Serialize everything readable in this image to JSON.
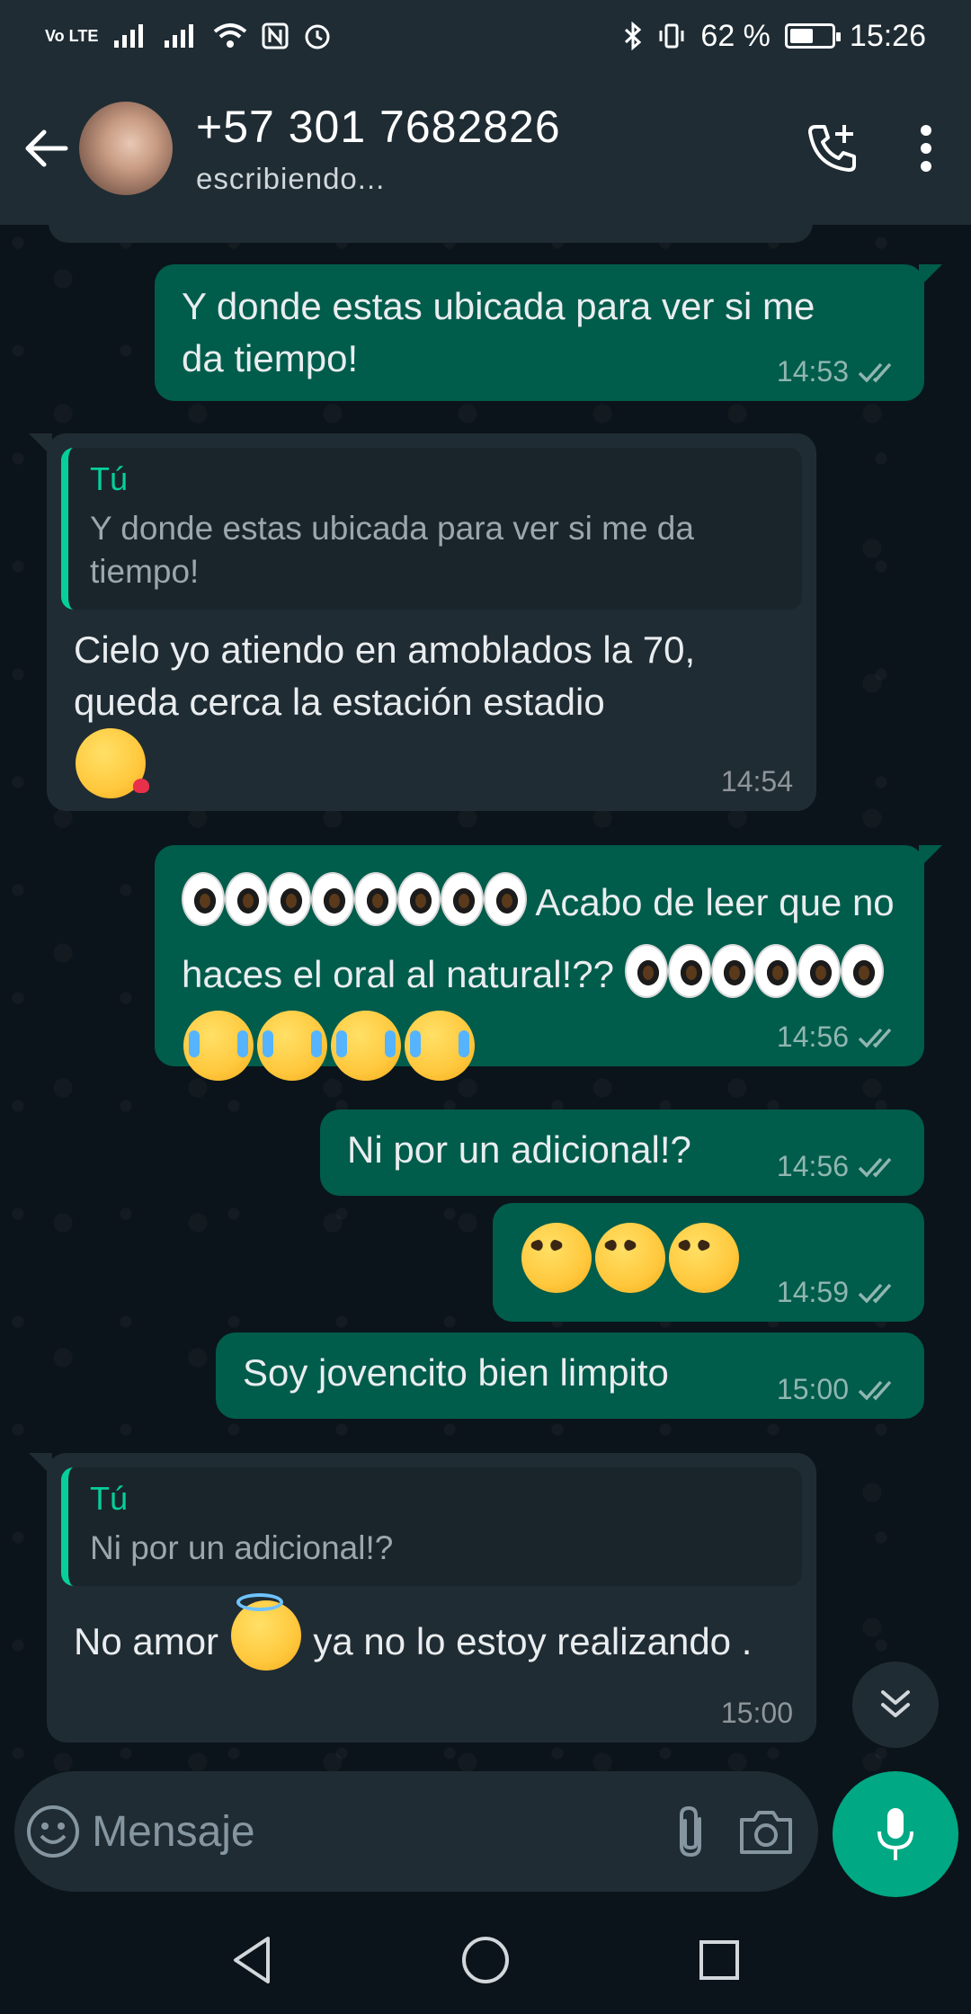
{
  "status_bar": {
    "left_network": "Vo LTE",
    "battery_percent_text": "62 %",
    "battery_level": 0.62,
    "time": "15:26"
  },
  "header": {
    "contact_name": "+57 301 7682826",
    "contact_status": "escribiendo..."
  },
  "messages": [
    {
      "direction": "out",
      "text": "Y donde estas ubicada para ver si me da tiempo!",
      "time": "14:53",
      "status": "read"
    },
    {
      "direction": "in",
      "quote_author": "Tú",
      "quote_text": "Y donde estas ubicada para ver si me da tiempo!",
      "text": "Cielo yo atiendo en amoblados la 70, queda cerca la estación estadio",
      "emoji": "kissing-face-with-heart",
      "time": "14:54"
    },
    {
      "direction": "out",
      "text": "Acabo de leer que no haces el oral al natural!??",
      "emoji_before": "eyes x4",
      "emoji_after": "eyes x3, crying x4",
      "time": "14:56",
      "status": "read"
    },
    {
      "direction": "out",
      "text": "Ni por un adicional!?",
      "time": "14:56",
      "status": "read"
    },
    {
      "direction": "out",
      "text": "",
      "emoji": "pleading-face x3",
      "time": "14:59",
      "status": "read"
    },
    {
      "direction": "out",
      "text": "Soy jovencito bien limpito",
      "time": "15:00",
      "status": "read"
    },
    {
      "direction": "in",
      "quote_author": "Tú",
      "quote_text": "Ni por un adicional!?",
      "text_part1": "No amor",
      "emoji": "smiling-face-with-halo",
      "text_part2": "ya no lo estoy realizando .",
      "time": "15:00"
    }
  ],
  "composer": {
    "placeholder": "Mensaje"
  },
  "colors": {
    "outgoing_bubble": "#005c4b",
    "incoming_bubble": "#202c33",
    "accent": "#00a884",
    "quote_accent": "#06cf9c",
    "header": "#1f2c34",
    "background": "#0b141a"
  },
  "icons": [
    "back-arrow-icon",
    "add-call-icon",
    "more-vert-icon",
    "emoji-icon",
    "attach-icon",
    "camera-icon",
    "mic-icon",
    "scroll-down-icon",
    "nav-back-icon",
    "nav-home-icon",
    "nav-recents-icon",
    "read-receipt-icon"
  ]
}
